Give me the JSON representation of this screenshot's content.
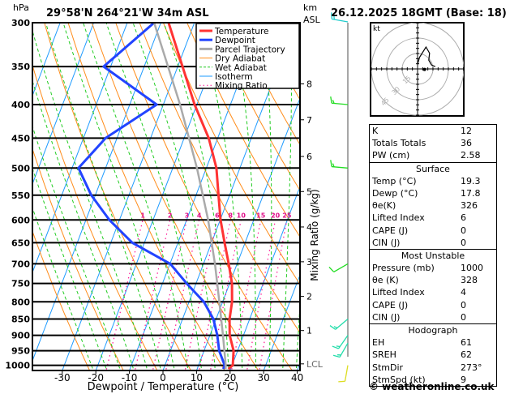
{
  "header": {
    "pressure_unit": "hPa",
    "location": "29°58'N  264°21'W  34m  ASL",
    "height_unit": "km",
    "height_ref": "ASL",
    "datetime": "26.12.2025  18GMT  (Base: 18)"
  },
  "chart_data": {
    "type": "skew-t",
    "xlabel": "Dewpoint / Temperature (°C)",
    "ylabel_right": "Mixing Ratio (g/kg)",
    "xlim": [
      -39,
      40
    ],
    "ylim_hpa": [
      1018,
      300
    ],
    "x_ticks": [
      "-30",
      "-20",
      "-10",
      "0",
      "10",
      "20",
      "30",
      "40"
    ],
    "x_tick_values": [
      -30,
      -20,
      -10,
      0,
      10,
      20,
      30,
      40
    ],
    "pressure_ticks": [
      300,
      350,
      400,
      450,
      500,
      550,
      600,
      650,
      700,
      750,
      800,
      850,
      900,
      950,
      1000
    ],
    "km_ticks": [
      {
        "label": "8",
        "p": 372
      },
      {
        "label": "7",
        "p": 422
      },
      {
        "label": "6",
        "p": 480
      },
      {
        "label": "5",
        "p": 543
      },
      {
        "label": "4",
        "p": 615
      },
      {
        "label": "3",
        "p": 695
      },
      {
        "label": "2",
        "p": 785
      },
      {
        "label": "1",
        "p": 885
      },
      {
        "label": "LCL",
        "p": 995
      }
    ],
    "mixing_ratio_labels": [
      "1",
      "2",
      "3",
      "4",
      "6",
      "8",
      "10",
      "15",
      "20",
      "25"
    ],
    "mixing_ratio_values": [
      1,
      2,
      3,
      4,
      6,
      8,
      10,
      15,
      20,
      25
    ],
    "legend": [
      {
        "name": "Temperature",
        "color": "#ff3333",
        "style": "thick"
      },
      {
        "name": "Dewpoint",
        "color": "#2244ff",
        "style": "thick"
      },
      {
        "name": "Parcel Trajectory",
        "color": "#aaaaaa",
        "style": "thick"
      },
      {
        "name": "Dry Adiabat",
        "color": "#ff8c1a",
        "style": "thin"
      },
      {
        "name": "Wet Adiabat",
        "color": "#22cc22",
        "style": "dashed"
      },
      {
        "name": "Isotherm",
        "color": "#1e9bff",
        "style": "thin"
      },
      {
        "name": "Mixing Ratio",
        "color": "#ff1493",
        "style": "dotted"
      }
    ],
    "legend_position": "top-right",
    "series": [
      {
        "name": "Temperature",
        "p": [
          1013,
          1000,
          950,
          900,
          850,
          800,
          750,
          700,
          650,
          600,
          550,
          500,
          450,
          400,
          350,
          300
        ],
        "t": [
          19.3,
          20.2,
          18.8,
          15.9,
          14.0,
          12.8,
          10.7,
          7.5,
          3.9,
          0.1,
          -3.3,
          -7.0,
          -12.7,
          -20.7,
          -28.6,
          -37.7
        ]
      },
      {
        "name": "Dewpoint",
        "p": [
          1013,
          1000,
          950,
          900,
          850,
          800,
          750,
          700,
          650,
          600,
          550,
          500,
          450,
          400,
          350,
          300
        ],
        "t": [
          17.8,
          17.8,
          14.5,
          12.2,
          9.2,
          4.4,
          -2.8,
          -9.9,
          -23.6,
          -33.0,
          -41.2,
          -48.1,
          -43.4,
          -32.0,
          -52.1,
          -42.0
        ]
      },
      {
        "name": "Parcel Trajectory",
        "p": [
          1013,
          1000,
          900,
          800,
          700,
          600,
          500,
          400,
          300
        ],
        "t": [
          18.5,
          18.1,
          13.9,
          9.0,
          3.4,
          -3.6,
          -12.8,
          -25.0,
          -42.0
        ]
      }
    ],
    "wind_barbs": [
      {
        "p": 300,
        "dir": 280,
        "speed_kt": 20,
        "color": "#22cccc"
      },
      {
        "p": 400,
        "dir": 275,
        "speed_kt": 15,
        "color": "#22dd22"
      },
      {
        "p": 500,
        "dir": 275,
        "speed_kt": 15,
        "color": "#22dd22"
      },
      {
        "p": 700,
        "dir": 240,
        "speed_kt": 10,
        "color": "#22dd22"
      },
      {
        "p": 850,
        "dir": 230,
        "speed_kt": 15,
        "color": "#22ddaa"
      },
      {
        "p": 900,
        "dir": 215,
        "speed_kt": 15,
        "color": "#22ddaa"
      },
      {
        "p": 925,
        "dir": 210,
        "speed_kt": 15,
        "color": "#22ddaa"
      },
      {
        "p": 1000,
        "dir": 190,
        "speed_kt": 10,
        "color": "#dddd22"
      }
    ],
    "hodograph": {
      "unit": "kt",
      "rings": [
        "15",
        "30",
        "45"
      ],
      "ring_values": [
        15,
        30,
        45
      ],
      "trace_uv": [
        [
          0,
          4.4
        ],
        [
          1.9,
          11.2
        ],
        [
          8.2,
          21.3
        ],
        [
          11.7,
          15.3
        ],
        [
          10.9,
          8.5
        ],
        [
          13.6,
          3.8
        ],
        [
          17.2,
          2.2
        ]
      ],
      "storm_motion_uv": [
        6.8,
        -0.5
      ]
    }
  },
  "indices": {
    "general": [
      {
        "label": "K",
        "value": "12"
      },
      {
        "label": "Totals Totals",
        "value": "36"
      },
      {
        "label": "PW (cm)",
        "value": "2.58"
      }
    ],
    "surface": {
      "title": "Surface",
      "rows": [
        {
          "label": "Temp (°C)",
          "value": "19.3"
        },
        {
          "label": "Dewp (°C)",
          "value": "17.8"
        },
        {
          "label": "θe(K)",
          "value": "326"
        },
        {
          "label": "Lifted Index",
          "value": "6"
        },
        {
          "label": "CAPE (J)",
          "value": "0"
        },
        {
          "label": "CIN (J)",
          "value": "0"
        }
      ]
    },
    "most_unstable": {
      "title": "Most Unstable",
      "rows": [
        {
          "label": "Pressure (mb)",
          "value": "1000"
        },
        {
          "label": "θe (K)",
          "value": "328"
        },
        {
          "label": "Lifted Index",
          "value": "4"
        },
        {
          "label": "CAPE (J)",
          "value": "0"
        },
        {
          "label": "CIN (J)",
          "value": "0"
        }
      ]
    },
    "hodograph": {
      "title": "Hodograph",
      "rows": [
        {
          "label": "EH",
          "value": "61"
        },
        {
          "label": "SREH",
          "value": "62"
        },
        {
          "label": "StmDir",
          "value": "273°"
        },
        {
          "label": "StmSpd (kt)",
          "value": "9"
        }
      ]
    }
  },
  "footer": "© weatheronline.co.uk"
}
